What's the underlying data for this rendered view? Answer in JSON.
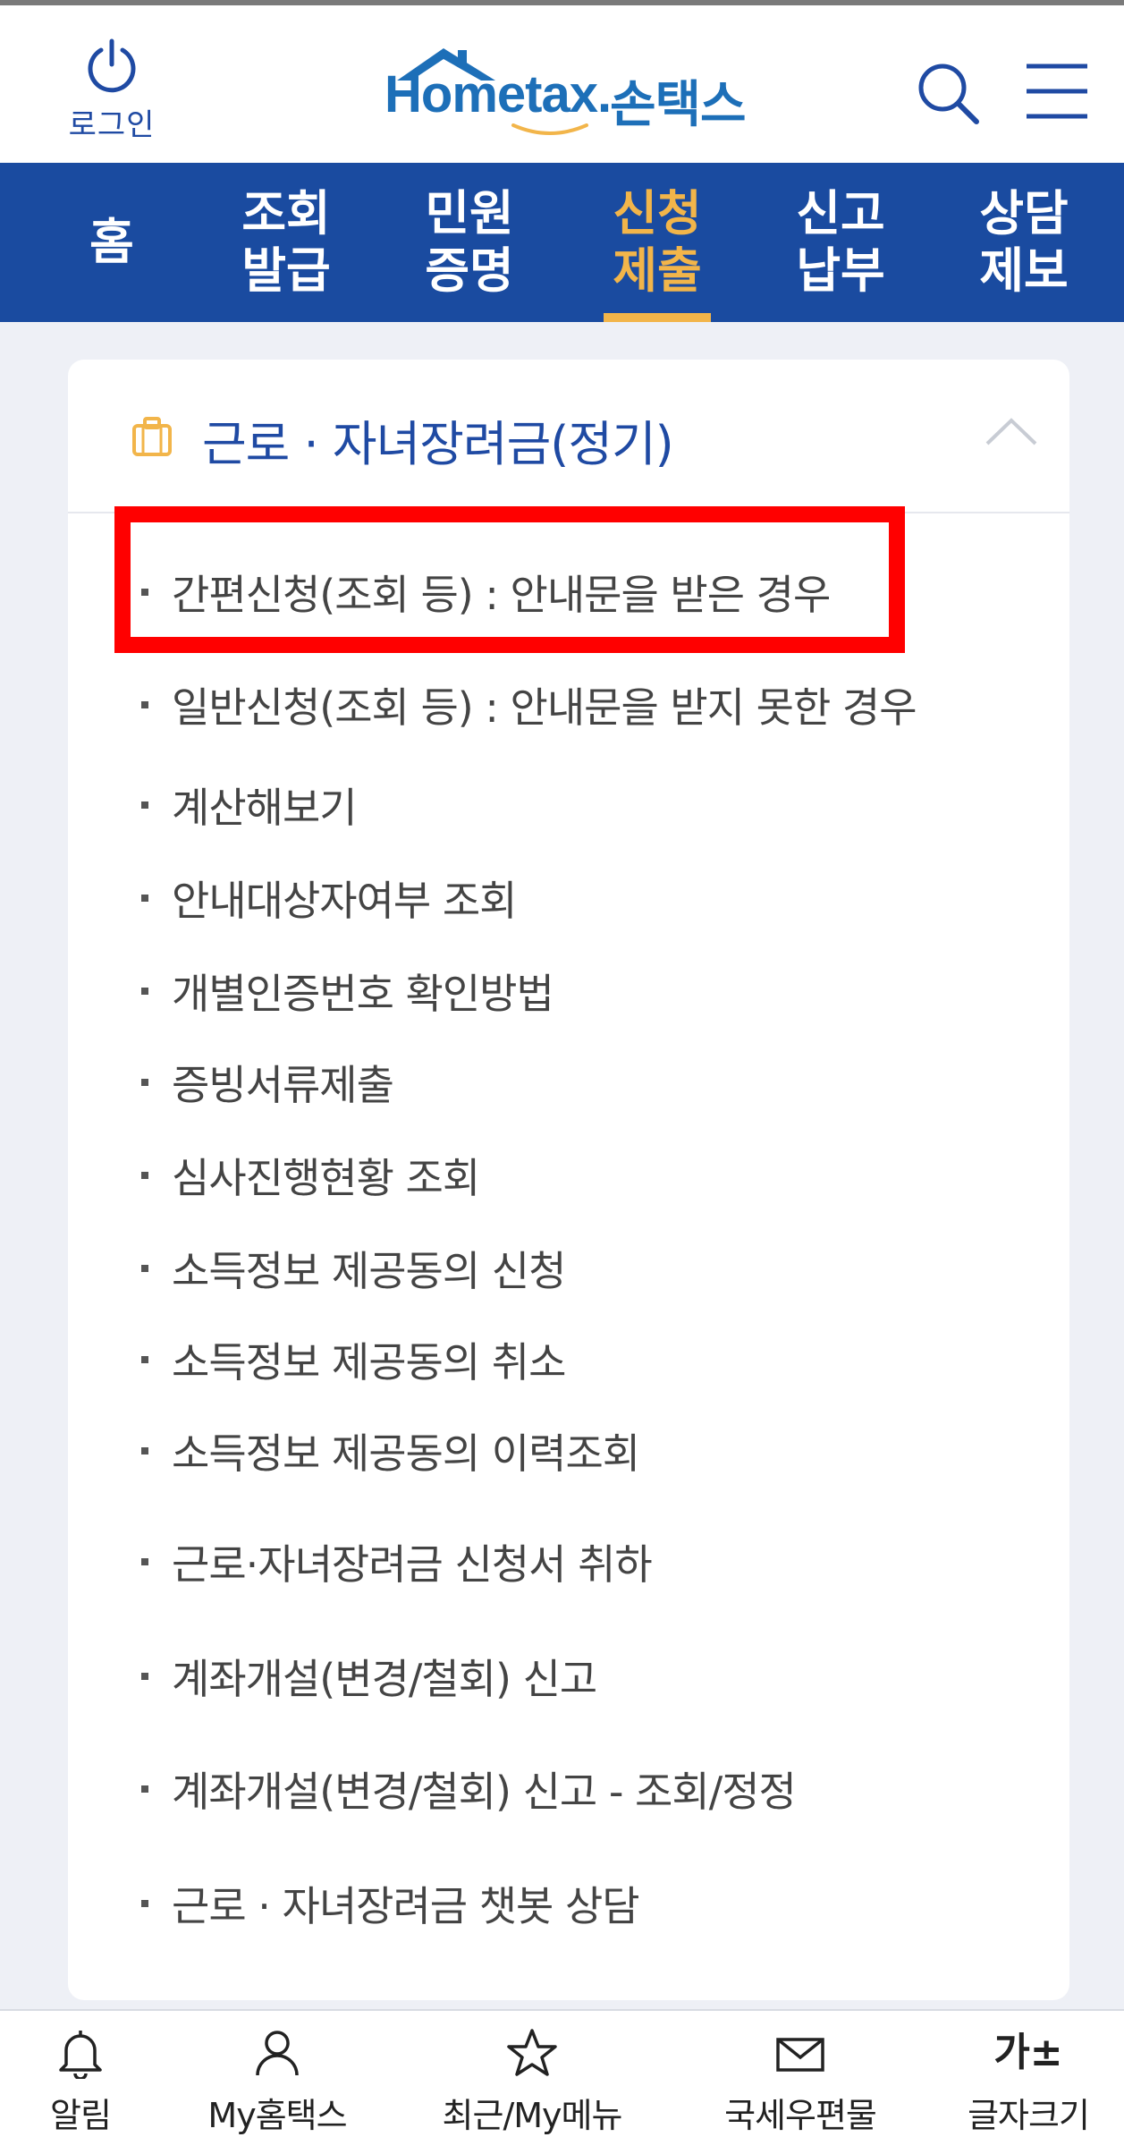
{
  "header": {
    "login_label": "로그인",
    "logo_en": "Hometax.",
    "logo_ko": "손택스"
  },
  "nav": {
    "items": [
      {
        "label": "홈",
        "active": false
      },
      {
        "label": "조회\n발급",
        "line1": "조회",
        "line2": "발급",
        "active": false
      },
      {
        "label": "민원\n증명",
        "line1": "민원",
        "line2": "증명",
        "active": false
      },
      {
        "label": "신청\n제출",
        "line1": "신청",
        "line2": "제출",
        "active": true
      },
      {
        "label": "신고\n납부",
        "line1": "신고",
        "line2": "납부",
        "active": false
      },
      {
        "label": "상담\n제보",
        "line1": "상담",
        "line2": "제보",
        "active": false
      }
    ]
  },
  "section": {
    "title": "근로 · 자녀장려금(정기)",
    "icon": "briefcase-icon",
    "expanded": true,
    "items": [
      "간편신청(조회 등) : 안내문을 받은 경우",
      "일반신청(조회 등) : 안내문을 받지 못한 경우",
      "계산해보기",
      "안내대상자여부 조회",
      "개별인증번호 확인방법",
      "증빙서류제출",
      "심사진행현황 조회",
      "소득정보 제공동의 신청",
      "소득정보 제공동의 취소",
      "소득정보 제공동의 이력조회",
      "근로·자녀장려금 신청서 취하",
      "계좌개설(변경/철회) 신고",
      "계좌개설(변경/철회) 신고 - 조회/정정",
      "근로 · 자녀장려금 챗봇 상담"
    ],
    "highlighted_index": 0
  },
  "bottom_bar": {
    "items": [
      {
        "label": "알림",
        "icon": "bell-icon"
      },
      {
        "label": "My홈택스",
        "icon": "person-icon"
      },
      {
        "label": "최근/My메뉴",
        "icon": "star-icon"
      },
      {
        "label": "국세우편물",
        "icon": "envelope-icon"
      },
      {
        "label": "글자크기",
        "icon": "font-size-icon",
        "glyph": "가±"
      }
    ]
  },
  "colors": {
    "brand_blue": "#1a4ba0",
    "active_orange": "#f2b54a",
    "highlight_red": "#ff0000",
    "background": "#eef0f6"
  }
}
